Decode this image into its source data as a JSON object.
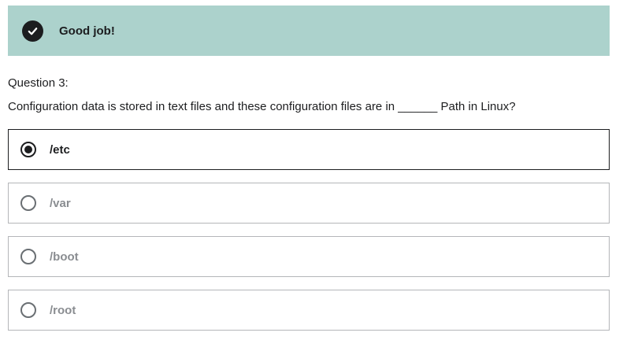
{
  "feedback": {
    "icon": "checkmark-icon",
    "text": "Good job!",
    "color": "#acd2cc"
  },
  "question": {
    "number_label": "Question 3:",
    "text": "Configuration data is stored in text files and these configuration files are in ______ Path in Linux?"
  },
  "answers": [
    {
      "label": "/etc",
      "selected": true
    },
    {
      "label": "/var",
      "selected": false
    },
    {
      "label": "/boot",
      "selected": false
    },
    {
      "label": "/root",
      "selected": false
    }
  ]
}
